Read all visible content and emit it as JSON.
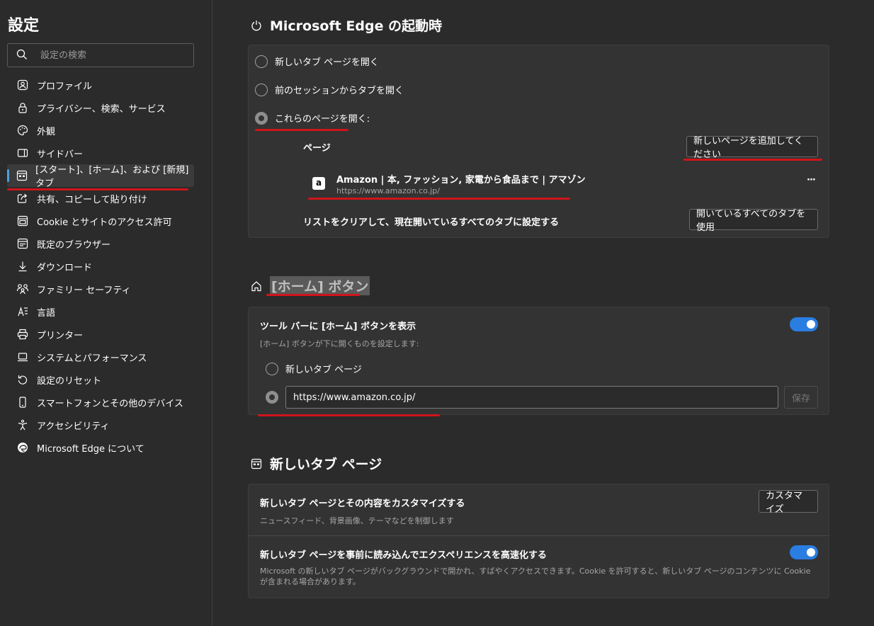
{
  "sidebar": {
    "title": "設定",
    "search_placeholder": "設定の検索",
    "items": [
      {
        "label": "プロファイル",
        "icon": "profile-icon"
      },
      {
        "label": "プライバシー、検索、サービス",
        "icon": "lock-icon"
      },
      {
        "label": "外観",
        "icon": "palette-icon"
      },
      {
        "label": "サイドバー",
        "icon": "sidebar-icon"
      },
      {
        "label": "[スタート]、[ホーム]、および [新規] タブ",
        "icon": "start-home-icon",
        "active": true
      },
      {
        "label": "共有、コピーして貼り付け",
        "icon": "share-icon"
      },
      {
        "label": "Cookie とサイトのアクセス許可",
        "icon": "cookie-icon"
      },
      {
        "label": "既定のブラウザー",
        "icon": "browser-icon"
      },
      {
        "label": "ダウンロード",
        "icon": "download-icon"
      },
      {
        "label": "ファミリー セーフティ",
        "icon": "family-icon"
      },
      {
        "label": "言語",
        "icon": "language-icon"
      },
      {
        "label": "プリンター",
        "icon": "printer-icon"
      },
      {
        "label": "システムとパフォーマンス",
        "icon": "laptop-icon"
      },
      {
        "label": "設定のリセット",
        "icon": "reset-icon"
      },
      {
        "label": "スマートフォンとその他のデバイス",
        "icon": "phone-icon"
      },
      {
        "label": "アクセシビリティ",
        "icon": "accessibility-icon"
      },
      {
        "label": "Microsoft Edge について",
        "icon": "edge-logo-icon"
      }
    ]
  },
  "startup": {
    "title": "Microsoft Edge の起動時",
    "options": [
      "新しいタブ ページを開く",
      "前のセッションからタブを開く",
      "これらのページを開く:"
    ],
    "selected": 2,
    "pages_label": "ページ",
    "add_page_button": "新しいページを追加してください",
    "page": {
      "title": "Amazon | 本, ファッション, 家電から食品まで | アマゾン",
      "url": "https://www.amazon.co.jp/",
      "favicon": "a"
    },
    "more_label": "···",
    "clear_label": "リストをクリアして、現在開いているすべてのタブに設定する",
    "use_all_tabs_button": "開いているすべてのタブを使用"
  },
  "home_button": {
    "title": "[ホーム] ボタン",
    "toggle_label": "ツール バーに [ホーム] ボタンを表示",
    "toggle_on": true,
    "description": "[ホーム] ボタンが下に開くものを設定します:",
    "option_new_tab": "新しいタブ ページ",
    "url_value": "https://www.amazon.co.jp/",
    "save_button": "保存"
  },
  "new_tab": {
    "title": "新しいタブ ページ",
    "customize_label": "新しいタブ ページとその内容をカスタマイズする",
    "customize_desc": "ニュースフィード、背景画像、テーマなどを制御します",
    "customize_button": "カスタマイズ",
    "preload_label": "新しいタブ ページを事前に読み込んでエクスペリエンスを高速化する",
    "preload_on": true,
    "preload_desc": "Microsoft の新しいタブ ページがバックグラウンドで開かれ、すばやくアクセスできます。Cookie を許可すると、新しいタブ ページのコンテンツに Cookie が含まれる場合があります。"
  },
  "colors": {
    "accent": "#2a7de1",
    "annotation_red": "#d0141a",
    "background": "#2b2b2b",
    "card": "#333333"
  }
}
